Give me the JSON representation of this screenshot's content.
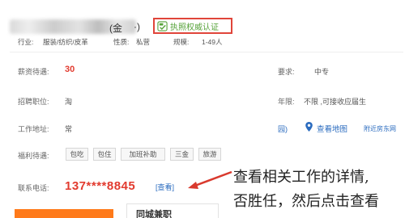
{
  "company": {
    "name_fragment": "(金",
    "name_suffix": "·)",
    "verify_badge": "执照权威认证"
  },
  "meta": {
    "industry_label": "行业:",
    "industry_value": "服装/纺织/皮革",
    "nature_label": "性质:",
    "nature_value": "私营",
    "scale_label": "规模:",
    "scale_value": "1-49人"
  },
  "rows": {
    "salary_label": "薪资待遇:",
    "salary_value": "30",
    "education_label": "要求:",
    "education_value": "中专",
    "position_label": "招聘职位:",
    "position_value": "淘",
    "age_label": "年限:",
    "age_value": "不限 ,可接收应届生",
    "address_label": "工作地址:",
    "address_value": "常",
    "address_paren": "园)",
    "map_link": "查看地图",
    "nearby_link": "附近房东网",
    "welfare_label": "福利待遇:",
    "welfare_tags": [
      "包吃",
      "包住",
      "加班补助",
      "三金",
      "旅游"
    ]
  },
  "contact": {
    "phone_label": "联系电话:",
    "phone_masked": "137****8845",
    "view_link": "[查看]"
  },
  "annotation": {
    "line1": "查看相关工作的详情,",
    "line2": "否胜任，然后点击查看"
  },
  "bottom": {
    "card_label": "同城兼职"
  },
  "colors": {
    "accent_red": "#e23b2f",
    "badge_border": "#e0453a",
    "badge_green": "#57a33a",
    "link_blue": "#2a6bbf",
    "orange": "#ff7a1a"
  }
}
